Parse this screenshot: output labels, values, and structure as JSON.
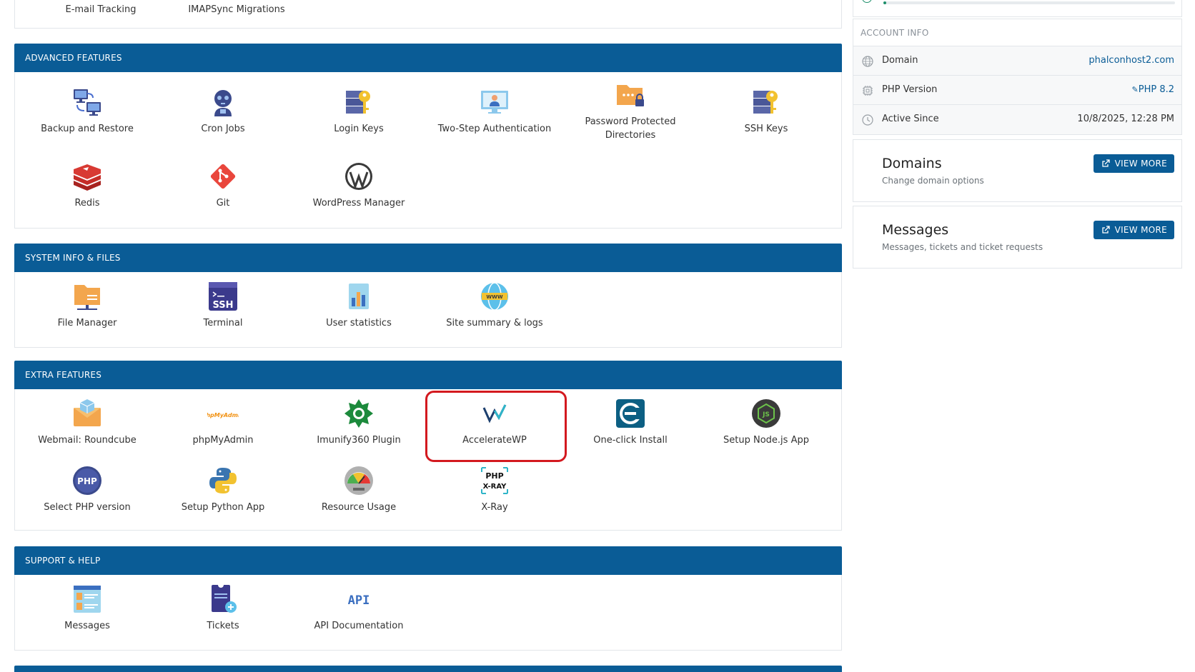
{
  "top_panel": {
    "items": [
      "E-mail Tracking",
      "IMAPSync Migrations"
    ]
  },
  "sections": [
    {
      "title": "ADVANCED FEATURES",
      "items": [
        {
          "label": "Backup and Restore",
          "icon": "backup-restore-icon"
        },
        {
          "label": "Cron Jobs",
          "icon": "cron-jobs-icon"
        },
        {
          "label": "Login Keys",
          "icon": "login-keys-icon"
        },
        {
          "label": "Two-Step Authentication",
          "icon": "two-step-auth-icon"
        },
        {
          "label": "Password Protected Directories",
          "icon": "password-folder-icon"
        },
        {
          "label": "SSH Keys",
          "icon": "ssh-keys-icon"
        },
        {
          "label": "Redis",
          "icon": "redis-icon"
        },
        {
          "label": "Git",
          "icon": "git-icon"
        },
        {
          "label": "WordPress Manager",
          "icon": "wordpress-icon"
        }
      ]
    },
    {
      "title": "SYSTEM INFO & FILES",
      "items": [
        {
          "label": "File Manager",
          "icon": "file-manager-icon"
        },
        {
          "label": "Terminal",
          "icon": "terminal-icon"
        },
        {
          "label": "User statistics",
          "icon": "user-statistics-icon"
        },
        {
          "label": "Site summary & logs",
          "icon": "site-summary-icon"
        }
      ]
    },
    {
      "title": "EXTRA FEATURES",
      "items": [
        {
          "label": "Webmail: Roundcube",
          "icon": "roundcube-icon"
        },
        {
          "label": "phpMyAdmin",
          "icon": "phpmyadmin-icon"
        },
        {
          "label": "Imunify360 Plugin",
          "icon": "imunify360-icon"
        },
        {
          "label": "AccelerateWP",
          "icon": "acceleratewp-icon"
        },
        {
          "label": "One-click Install",
          "icon": "one-click-install-icon"
        },
        {
          "label": "Setup Node.js App",
          "icon": "nodejs-icon"
        },
        {
          "label": "Select PHP version",
          "icon": "php-version-icon"
        },
        {
          "label": "Setup Python App",
          "icon": "python-icon"
        },
        {
          "label": "Resource Usage",
          "icon": "resource-usage-icon"
        },
        {
          "label": "X-Ray",
          "icon": "xray-icon"
        }
      ]
    },
    {
      "title": "SUPPORT & HELP",
      "items": [
        {
          "label": "Messages",
          "icon": "messages-icon"
        },
        {
          "label": "Tickets",
          "icon": "tickets-icon"
        },
        {
          "label": "API Documentation",
          "icon": "api-documentation-icon"
        }
      ]
    }
  ],
  "icon_text": {
    "phpmyadmin": "phpMyAdmin",
    "php": "PHP",
    "ssh": "SSH",
    "xray_top": "PHP",
    "xray_bottom": "X-RAY",
    "api": "API",
    "www": "WWW"
  },
  "account_info": {
    "heading": "ACCOUNT INFO",
    "rows": [
      {
        "label": "Domain",
        "value": "phalconhost2.com",
        "icon": "globe-icon"
      },
      {
        "label": "PHP Version",
        "value": "PHP 8.2",
        "icon": "chip-icon"
      },
      {
        "label": "Active Since",
        "value": "10/8/2025, 12:28 PM",
        "icon": "clock-icon"
      }
    ]
  },
  "usage_progress": 0.01,
  "cards": [
    {
      "title": "Domains",
      "subtitle": "Change domain options",
      "button": "VIEW MORE"
    },
    {
      "title": "Messages",
      "subtitle": "Messages, tickets and ticket requests",
      "button": "VIEW MORE"
    }
  ],
  "colors": {
    "header_bg": "#0a5c96",
    "highlight": "#d3191f",
    "link": "#0a5c96",
    "progress": "#1d8f6a"
  }
}
